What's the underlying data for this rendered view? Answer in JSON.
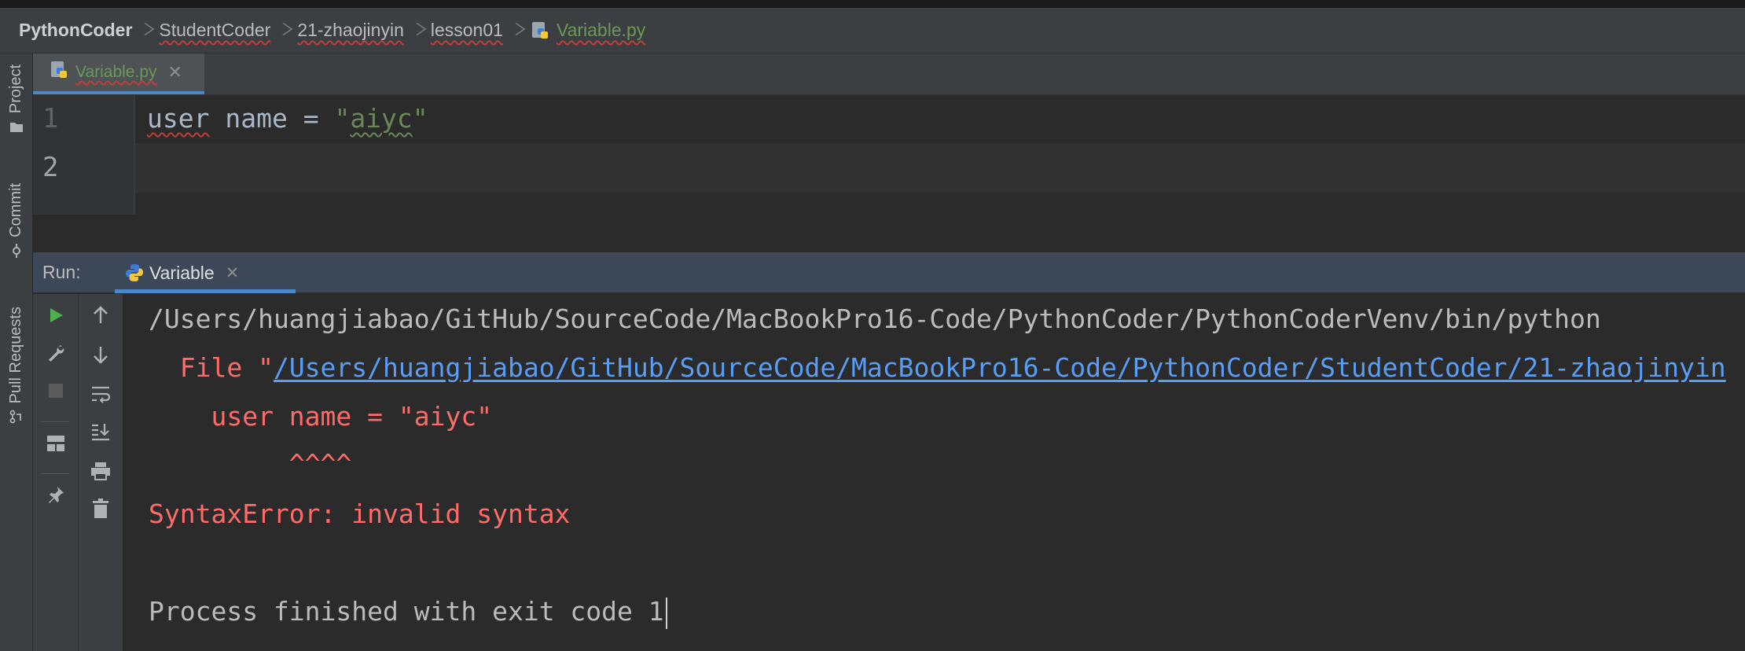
{
  "breadcrumb": {
    "project": "PythonCoder",
    "items": [
      "StudentCoder",
      "21-zhaojinyin",
      "lesson01"
    ],
    "file": "Variable.py"
  },
  "sidebar": {
    "project": "Project",
    "commit": "Commit",
    "pull_requests": "Pull Requests"
  },
  "editor": {
    "tab_label": "Variable.py",
    "line_numbers": [
      "1",
      "2"
    ],
    "code": {
      "ident": "user",
      "rest": " name = ",
      "str_open": "\"",
      "str_body": "aiyc",
      "str_close": "\""
    }
  },
  "run": {
    "label": "Run:",
    "tab_label": "Variable",
    "console": {
      "line1": "/Users/huangjiabao/GitHub/SourceCode/MacBookPro16-Code/PythonCoder/PythonCoderVenv/bin/python",
      "file_prefix": "  File \"",
      "file_link": "/Users/huangjiabao/GitHub/SourceCode/MacBookPro16-Code/PythonCoder/StudentCoder/21-zhaojinyin",
      "code_line": "    user name = \"aiyc\"",
      "carets": "         ^^^^",
      "error": "SyntaxError: invalid syntax",
      "exit": "Process finished with exit code 1"
    }
  },
  "colors": {
    "error_red": "#ff6b68",
    "link_blue": "#589df6",
    "run_green": "#4caf50",
    "accent_blue": "#4a88c7"
  }
}
